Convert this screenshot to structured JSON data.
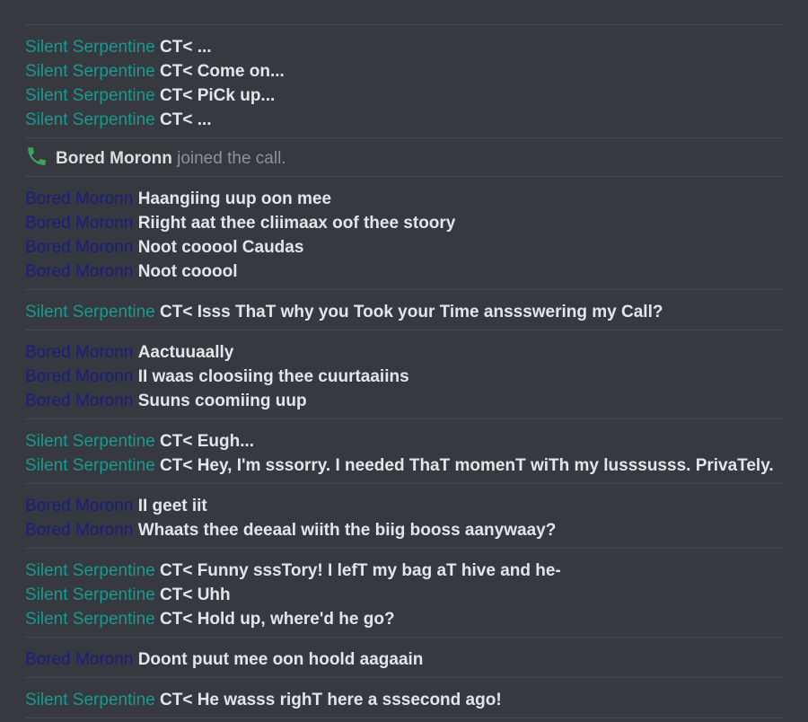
{
  "colors": {
    "background": "#36393f",
    "divider": "#44474e",
    "silent_serpentine": "#1a9a8f",
    "bored_moronn": "#1a1d80",
    "message_text": "#e3e5e8",
    "system_text": "#8e9297",
    "call_icon": "#3ba55c"
  },
  "messages": [
    {
      "type": "group",
      "lines": [
        {
          "author": "Silent Serpentine",
          "text": "CT< ..."
        },
        {
          "author": "Silent Serpentine",
          "text": "CT< Come on..."
        },
        {
          "author": "Silent Serpentine",
          "text": "CT< PiCk up..."
        },
        {
          "author": "Silent Serpentine",
          "text": "CT< ..."
        }
      ]
    },
    {
      "type": "system",
      "icon": "phone-icon",
      "who": "Bored Moronn",
      "what": " joined the call."
    },
    {
      "type": "group",
      "lines": [
        {
          "author": "Bored Moronn",
          "text": "Haangiing uup oon mee"
        },
        {
          "author": "Bored Moronn",
          "text": "Riight aat thee cliimaax oof thee stoory"
        },
        {
          "author": "Bored Moronn",
          "text": "Noot cooool Caudas"
        },
        {
          "author": "Bored Moronn",
          "text": "Noot cooool"
        }
      ]
    },
    {
      "type": "group",
      "lines": [
        {
          "author": "Silent Serpentine",
          "text": "CT< Isss ThaT why you Took your Time anssswering my Call?"
        }
      ]
    },
    {
      "type": "group",
      "lines": [
        {
          "author": "Bored Moronn",
          "text": "Aactuuaally"
        },
        {
          "author": "Bored Moronn",
          "text": "II waas cloosiing thee cuurtaaiins"
        },
        {
          "author": "Bored Moronn",
          "text": "Suuns coomiing uup"
        }
      ]
    },
    {
      "type": "group",
      "lines": [
        {
          "author": "Silent Serpentine",
          "text": "CT< Eugh..."
        },
        {
          "author": "Silent Serpentine",
          "text": "CT< Hey, I'm sssorry. I needed ThaT momenT wiTh my lusssusss. PrivaTely."
        }
      ]
    },
    {
      "type": "group",
      "lines": [
        {
          "author": "Bored Moronn",
          "text": "II geet iit"
        },
        {
          "author": "Bored Moronn",
          "text": "Whaats thee deeaal wiith the biig booss aanywaay?"
        }
      ]
    },
    {
      "type": "group",
      "lines": [
        {
          "author": "Silent Serpentine",
          "text": "CT< Funny sssTory! I lefT my bag aT hive and he-"
        },
        {
          "author": "Silent Serpentine",
          "text": "CT< Uhh"
        },
        {
          "author": "Silent Serpentine",
          "text": "CT< Hold up, where'd he go?"
        }
      ]
    },
    {
      "type": "group",
      "lines": [
        {
          "author": "Bored Moronn",
          "text": "Doont puut mee oon hoold aagaain"
        }
      ]
    },
    {
      "type": "group",
      "lines": [
        {
          "author": "Silent Serpentine",
          "text": "CT< He wasss righT here a sssecond ago!"
        }
      ]
    }
  ]
}
